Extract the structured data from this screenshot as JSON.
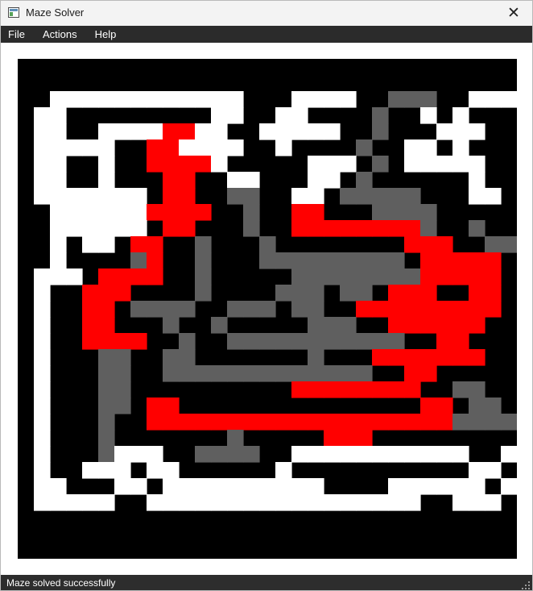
{
  "window": {
    "title": "Maze Solver",
    "icon": "app-window-icon",
    "close_glyph": "✕"
  },
  "menubar": {
    "items": [
      {
        "label": "File"
      },
      {
        "label": "Actions"
      },
      {
        "label": "Help"
      }
    ]
  },
  "maze": {
    "rows": 31,
    "cols": 31,
    "colors": {
      "wall": "#000000",
      "open": "#ffffff",
      "explored": "#5f5f5f",
      "solution": "#ff0000"
    },
    "grid": [
      "###############################",
      "###############################",
      "##WWWWWWWWWWWW###WWWW##EEE##WWWW#",
      "#WW#########WW##WW####E##W#W#",
      "#WW##WWWWRRWW##WWWWW##E###WWW#",
      "#WWWWW##RRWWWW##W####E##WW#W#",
      "#WW##W##RRRRW#####WWW#E#WWWWW#",
      "#WW##W###RR##WW###WW#E######W#",
      "#WWWWWWW#RR##EE##WW#EEEEE###WW",
      "##WWWWWWRRRR##E##RR###EEEE####",
      "##WWWWWW#RR###E##RRRRRRRRE##E#",
      "##W#WW#RR##E###E########RRR##EE",
      "##W####ER##E###EEEEEEEEE#RRRRR#",
      "#WWW#RRRR##E#####EEEEEEEERRRRR#",
      "#W##RRR####E####EEE#EE#RRR##RR#",
      "#W##RR#EEEE##EEE#EE##RRRRRRRRR#",
      "#W##RR###E##E#####EEE##RRRRRR#",
      "#W##RRRR##E##EEEEEEEEEEE##RR###",
      "#W###EE##EE#######E###RRRRRRR##",
      "#W###EE##EEEEEEEEEEEEE##RR#####",
      "#W###EE##########RRRRRRRR##EE##",
      "#W###EE#RR###############RR#EE#",
      "#W###E##RRRRRRRRRRRRRRRRRRREEEE#",
      "#W###E#######E#####RRR#######",
      "#W###EWWW##EEEE##WWWWWWWWWWW##WW",
      "#W##WWW#WW######W###########WW",
      "#WW###WW#WWWWWWWWWW####WWWWWW#W",
      "#WWWWW##WWWWWWWWWWWWWWWWW##WWW#",
      "###############################",
      "###############################",
      "###############################"
    ]
  },
  "statusbar": {
    "text": "Maze solved successfully"
  }
}
